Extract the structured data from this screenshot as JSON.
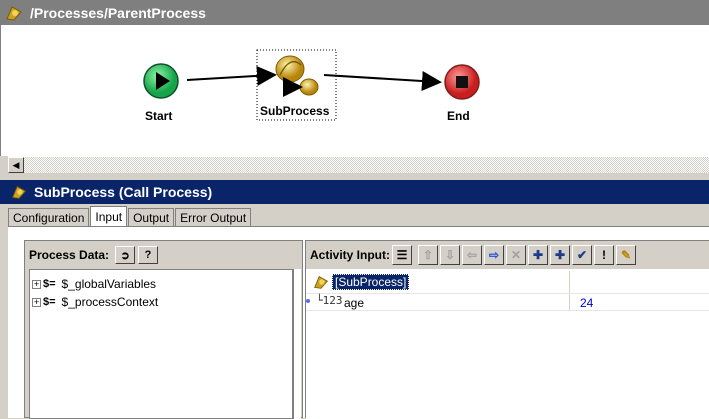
{
  "process": {
    "path": "/Processes/ParentProcess"
  },
  "canvas": {
    "start_label": "Start",
    "subprocess_label": "SubProcess",
    "end_label": "End"
  },
  "activity": {
    "title": "SubProcess (Call Process)"
  },
  "tabs": [
    {
      "label": "Configuration"
    },
    {
      "label": "Input"
    },
    {
      "label": "Output"
    },
    {
      "label": "Error Output"
    }
  ],
  "process_data": {
    "header": "Process Data:",
    "items": [
      {
        "label": "$_globalVariables"
      },
      {
        "label": "$_processContext"
      }
    ]
  },
  "activity_input": {
    "header": "Activity Input:",
    "root_label": "[SubProcess]",
    "fields": [
      {
        "name": "age",
        "value": "24"
      }
    ]
  },
  "colors": {
    "titlebar": "#0a246a",
    "start": "#22c55e",
    "end": "#dc2626",
    "value_text": "#0000cc"
  }
}
